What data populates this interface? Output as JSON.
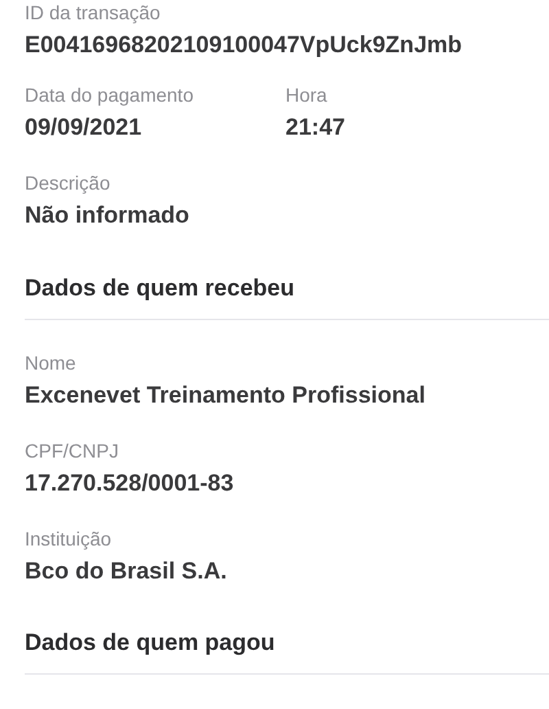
{
  "transaction": {
    "id": {
      "label": "ID da transação",
      "value": "E00416968202109100047VpUck9ZnJmb"
    },
    "date": {
      "label": "Data do pagamento",
      "value": "09/09/2021"
    },
    "time": {
      "label": "Hora",
      "value": "21:47"
    },
    "description": {
      "label": "Descrição",
      "value": "Não informado"
    }
  },
  "sections": [
    {
      "title": "Dados de quem recebeu",
      "fields": [
        {
          "label": "Nome",
          "value": "Excenevet Treinamento Profissional"
        },
        {
          "label": "CPF/CNPJ",
          "value": "17.270.528/0001-83"
        },
        {
          "label": "Instituição",
          "value": "Bco do Brasil S.A."
        }
      ]
    },
    {
      "title": "Dados de quem pagou"
    }
  ]
}
